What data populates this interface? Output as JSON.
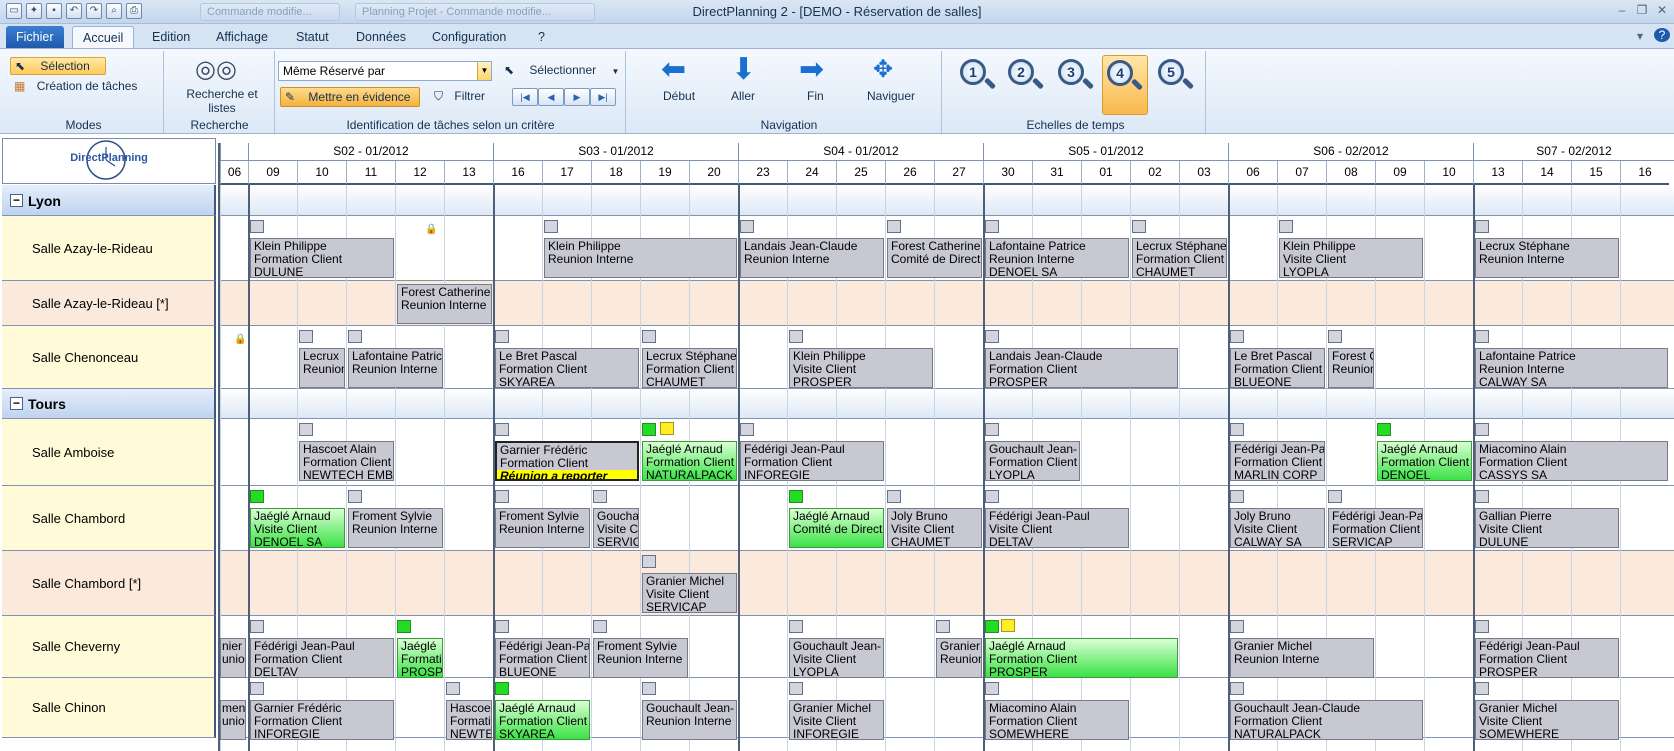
{
  "window": {
    "title": "DirectPlanning 2 - [DEMO - Réservation de salles]",
    "ghost_tabs": [
      "Commande modifie...",
      "Planning Projet - Commande modifie..."
    ]
  },
  "menu_tabs": [
    "Fichier",
    "Accueil",
    "Edition",
    "Affichage",
    "Statut",
    "Données",
    "Configuration",
    "?"
  ],
  "ribbon": {
    "modes": {
      "label": "Modes",
      "selection": "Sélection",
      "creation": "Création de tâches"
    },
    "recherche": {
      "label": "Recherche",
      "button": "Recherche et listes"
    },
    "identification": {
      "label": "Identification de tâches selon un critère",
      "combo": "Même Réservé par",
      "select": "Sélectionner",
      "highlight": "Mettre en évidence",
      "filter": "Filtrer"
    },
    "navigation": {
      "label": "Navigation",
      "debut": "Début",
      "aller": "Aller",
      "fin": "Fin",
      "naviguer": "Naviguer"
    },
    "echelles": {
      "label": "Echelles de temps",
      "levels": [
        "1",
        "2",
        "3",
        "4",
        "5"
      ],
      "selected": "4"
    }
  },
  "logo_text": "DirectPlanning",
  "weeks": [
    "S02 - 01/2012",
    "S03 - 01/2012",
    "S04 - 01/2012",
    "S05 - 01/2012",
    "S06 - 02/2012",
    "S07 - 02/2012"
  ],
  "days": [
    "06",
    "09",
    "10",
    "11",
    "12",
    "13",
    "16",
    "17",
    "18",
    "19",
    "20",
    "23",
    "24",
    "25",
    "26",
    "27",
    "30",
    "31",
    "01",
    "02",
    "03",
    "06",
    "07",
    "08",
    "09",
    "10",
    "13",
    "14",
    "15",
    "16"
  ],
  "rows": [
    {
      "type": "group",
      "label": "Lyon"
    },
    {
      "type": "room",
      "label": "Salle Azay-le-Rideau"
    },
    {
      "type": "room",
      "label": "Salle Azay-le-Rideau [*]",
      "alt": true
    },
    {
      "type": "room",
      "label": "Salle Chenonceau"
    },
    {
      "type": "group",
      "label": "Tours"
    },
    {
      "type": "room",
      "label": "Salle Amboise"
    },
    {
      "type": "room",
      "label": "Salle Chambord"
    },
    {
      "type": "room",
      "label": "Salle Chambord [*]",
      "alt": true
    },
    {
      "type": "room",
      "label": "Salle Cheverny"
    },
    {
      "type": "room",
      "label": "Salle Chinon"
    }
  ],
  "tasks": [
    {
      "row": 1,
      "start": 1,
      "span": 3,
      "lines": [
        "Klein Philippe",
        "Formation Client",
        "DULUNE"
      ]
    },
    {
      "row": 1,
      "start": 7,
      "span": 4,
      "lines": [
        "Klein Philippe",
        "Reunion Interne"
      ]
    },
    {
      "row": 1,
      "start": 11,
      "span": 3,
      "lines": [
        "Landais Jean-Claude",
        "Reunion Interne"
      ]
    },
    {
      "row": 1,
      "start": 14,
      "span": 2,
      "lines": [
        "Forest Catherine",
        "Comité de Directi"
      ]
    },
    {
      "row": 1,
      "start": 16,
      "span": 3,
      "lines": [
        "Lafontaine Patrice",
        "Reunion Interne",
        "DENOEL SA"
      ]
    },
    {
      "row": 1,
      "start": 19,
      "span": 2,
      "lines": [
        "Lecrux Stéphane",
        "Formation Client",
        "CHAUMET"
      ]
    },
    {
      "row": 1,
      "start": 22,
      "span": 3,
      "lines": [
        "Klein Philippe",
        "Visite Client",
        "LYOPLA"
      ]
    },
    {
      "row": 1,
      "start": 26,
      "span": 3,
      "lines": [
        "Lecrux Stéphane",
        "Reunion Interne"
      ]
    },
    {
      "row": 2,
      "start": 4,
      "span": 2,
      "lines": [
        "Forest Catherine",
        "Reunion Interne"
      ]
    },
    {
      "row": 3,
      "start": 2,
      "span": 1,
      "lines": [
        "Lecrux",
        "Reunion"
      ]
    },
    {
      "row": 3,
      "start": 3,
      "span": 2,
      "lines": [
        "Lafontaine Patric",
        "Reunion Interne"
      ]
    },
    {
      "row": 3,
      "start": 6,
      "span": 3,
      "lines": [
        "Le Bret Pascal",
        "Formation Client",
        "SKYAREA"
      ]
    },
    {
      "row": 3,
      "start": 9,
      "span": 2,
      "lines": [
        "Lecrux Stéphane",
        "Formation Client",
        "CHAUMET"
      ]
    },
    {
      "row": 3,
      "start": 12,
      "span": 3,
      "lines": [
        "Klein Philippe",
        "Visite Client",
        "PROSPER"
      ]
    },
    {
      "row": 3,
      "start": 16,
      "span": 4,
      "lines": [
        "Landais Jean-Claude",
        "Formation Client",
        "PROSPER"
      ]
    },
    {
      "row": 3,
      "start": 21,
      "span": 2,
      "lines": [
        "Le Bret Pascal",
        "Formation Client",
        "BLUEONE"
      ]
    },
    {
      "row": 3,
      "start": 23,
      "span": 1,
      "lines": [
        "Forest C",
        "Reunion"
      ]
    },
    {
      "row": 3,
      "start": 26,
      "span": 4,
      "lines": [
        "Lafontaine Patrice",
        "Reunion Interne",
        "CALWAY SA"
      ]
    },
    {
      "row": 5,
      "start": 2,
      "span": 2,
      "lines": [
        "Hascoet Alain",
        "Formation Client",
        "NEWTECH EMB"
      ]
    },
    {
      "row": 5,
      "start": 6,
      "span": 3,
      "lines": [
        "Garnier Frédéric",
        "Formation Client"
      ],
      "warn": "Réunion a reporter"
    },
    {
      "row": 5,
      "start": 9,
      "span": 2,
      "lines": [
        "Jaéglé Arnaud",
        "Formation Client",
        "NATURALPACK"
      ],
      "green": true
    },
    {
      "row": 5,
      "start": 11,
      "span": 3,
      "lines": [
        "Fédérigi Jean-Paul",
        "Formation Client",
        "INFOREGIE"
      ]
    },
    {
      "row": 5,
      "start": 16,
      "span": 2,
      "lines": [
        "Gouchault Jean-",
        "Formation Client",
        "LYOPLA"
      ]
    },
    {
      "row": 5,
      "start": 21,
      "span": 2,
      "lines": [
        "Fédérigi Jean-Pa",
        "Formation Client",
        "MARLIN CORP"
      ]
    },
    {
      "row": 5,
      "start": 24,
      "span": 2,
      "lines": [
        "Jaéglé Arnaud",
        "Formation Client",
        "DENOEL"
      ],
      "green": true
    },
    {
      "row": 5,
      "start": 26,
      "span": 4,
      "lines": [
        "Miacomino Alain",
        "Formation Client",
        "CASSYS SA"
      ]
    },
    {
      "row": 6,
      "start": 1,
      "span": 2,
      "lines": [
        "Jaéglé Arnaud",
        "Visite Client",
        "DENOEL SA"
      ],
      "green": true
    },
    {
      "row": 6,
      "start": 3,
      "span": 2,
      "lines": [
        "Froment Sylvie",
        "Reunion Interne"
      ]
    },
    {
      "row": 6,
      "start": 6,
      "span": 2,
      "lines": [
        "Froment Sylvie",
        "Reunion Interne"
      ]
    },
    {
      "row": 6,
      "start": 8,
      "span": 1,
      "lines": [
        "Gouchaul",
        "Visite Cli",
        "SERVIC"
      ]
    },
    {
      "row": 6,
      "start": 12,
      "span": 2,
      "lines": [
        "Jaéglé Arnaud",
        "Comité de Directi"
      ],
      "green": true
    },
    {
      "row": 6,
      "start": 14,
      "span": 2,
      "lines": [
        "Joly Bruno",
        "Visite Client",
        "CHAUMET"
      ]
    },
    {
      "row": 6,
      "start": 16,
      "span": 3,
      "lines": [
        "Fédérigi Jean-Paul",
        "Visite Client",
        "DELTAV"
      ]
    },
    {
      "row": 6,
      "start": 21,
      "span": 2,
      "lines": [
        "Joly Bruno",
        "Visite Client",
        "CALWAY SA"
      ]
    },
    {
      "row": 6,
      "start": 23,
      "span": 2,
      "lines": [
        "Fédérigi Jean-Pa",
        "Formation Client",
        "SERVICAP"
      ]
    },
    {
      "row": 6,
      "start": 26,
      "span": 3,
      "lines": [
        "Gallian Pierre",
        "Visite Client",
        "DULUNE"
      ]
    },
    {
      "row": 7,
      "start": 9,
      "span": 2,
      "lines": [
        "Granier Michel",
        "Visite Client",
        "SERVICAP"
      ]
    },
    {
      "row": 8,
      "start": 1,
      "span": 3,
      "lines": [
        "Fédérigi Jean-Paul",
        "Formation Client",
        "DELTAV"
      ]
    },
    {
      "row": 8,
      "start": 4,
      "span": 1,
      "lines": [
        "Jaéglé",
        "Formati",
        "PROSP"
      ],
      "green": true
    },
    {
      "row": 8,
      "start": 6,
      "span": 2,
      "lines": [
        "Fédérigi Jean-Pa",
        "Formation Client",
        "BLUEONE"
      ]
    },
    {
      "row": 8,
      "start": 8,
      "span": 2,
      "lines": [
        "Froment Sylvie",
        "Reunion Interne"
      ]
    },
    {
      "row": 8,
      "start": 12,
      "span": 2,
      "lines": [
        "Gouchault Jean-",
        "Visite Client",
        "LYOPLA"
      ]
    },
    {
      "row": 8,
      "start": 15,
      "span": 1,
      "lines": [
        "Granier",
        "Reunion"
      ]
    },
    {
      "row": 8,
      "start": 16,
      "span": 4,
      "lines": [
        "Jaéglé Arnaud",
        "Formation Client",
        "PROSPER"
      ],
      "green": true
    },
    {
      "row": 8,
      "start": 21,
      "span": 3,
      "lines": [
        "Granier Michel",
        "Reunion Interne"
      ]
    },
    {
      "row": 8,
      "start": 26,
      "span": 3,
      "lines": [
        "Fédérigi Jean-Paul",
        "Formation Client",
        "PROSPER"
      ]
    },
    {
      "row": 9,
      "start": 1,
      "span": 3,
      "lines": [
        "Garnier Frédéric",
        "Formation Client",
        "INFOREGIE"
      ]
    },
    {
      "row": 9,
      "start": 5,
      "span": 1,
      "lines": [
        "Hascoet",
        "Formati",
        "NEWTE"
      ]
    },
    {
      "row": 9,
      "start": 6,
      "span": 2,
      "lines": [
        "Jaéglé Arnaud",
        "Formation Client",
        "SKYAREA"
      ],
      "green": true
    },
    {
      "row": 9,
      "start": 9,
      "span": 2,
      "lines": [
        "Gouchault Jean-",
        "Reunion Interne"
      ]
    },
    {
      "row": 9,
      "start": 12,
      "span": 2,
      "lines": [
        "Granier Michel",
        "Visite Client",
        "INFOREGIE"
      ]
    },
    {
      "row": 9,
      "start": 16,
      "span": 3,
      "lines": [
        "Miacomino Alain",
        "Formation Client",
        "SOMEWHERE"
      ]
    },
    {
      "row": 9,
      "start": 21,
      "span": 4,
      "lines": [
        "Gouchault Jean-Claude",
        "Formation Client",
        "NATURALPACK"
      ]
    },
    {
      "row": 9,
      "start": 26,
      "span": 3,
      "lines": [
        "Granier Michel",
        "Visite Client",
        "SOMEWHERE"
      ]
    }
  ],
  "left_clipped": [
    {
      "row": 8,
      "lines": [
        "nier",
        "unio"
      ]
    },
    {
      "row": 9,
      "lines": [
        "ment",
        "unio"
      ]
    }
  ],
  "colors": {
    "room_bg": "#fffbd9",
    "alt_bg": "#fbe9dc",
    "group_bg": "#c7d9f1",
    "task_gray": "#c8c8d3",
    "task_green": "#3be246",
    "warn_yellow": "#ffff00"
  }
}
